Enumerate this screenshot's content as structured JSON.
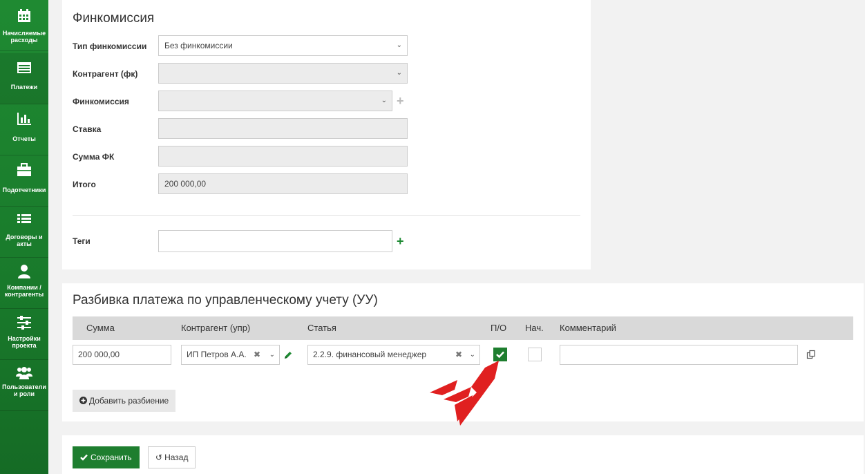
{
  "sidebar": {
    "items": [
      {
        "label": "Начисляемые расходы",
        "icon": "calendar-icon"
      },
      {
        "label": "Платежи",
        "icon": "payments-icon"
      },
      {
        "label": "Отчеты",
        "icon": "bar-chart-icon"
      },
      {
        "label": "Подотчетники",
        "icon": "briefcase-icon"
      },
      {
        "label": "Договоры и акты",
        "icon": "list-icon"
      },
      {
        "label": "Компании / контрагенты",
        "icon": "user-icon"
      },
      {
        "label": "Настройки проекта",
        "icon": "sliders-icon"
      },
      {
        "label": "Пользователи и роли",
        "icon": "users-icon"
      }
    ]
  },
  "fincommission": {
    "title": "Финкомиссия",
    "type_label": "Тип финкомиссии",
    "type_value": "Без финкомиссии",
    "counterparty_label": "Контрагент (фк)",
    "counterparty_value": "",
    "commission_label": "Финкомиссия",
    "commission_value": "",
    "rate_label": "Ставка",
    "rate_value": "",
    "sum_label": "Сумма ФК",
    "sum_value": "",
    "total_label": "Итого",
    "total_value": "200 000,00",
    "tags_label": "Теги",
    "tags_value": ""
  },
  "split": {
    "title": "Разбивка платежа по управленческому учету (УУ)",
    "columns": {
      "sum": "Сумма",
      "counterparty": "Контрагент (упр)",
      "article": "Статья",
      "po": "П/О",
      "nach": "Нач.",
      "comment": "Комментарий"
    },
    "row": {
      "sum": "200 000,00",
      "counterparty": "ИП Петров А.А.",
      "article": "2.2.9. финансовый менеджер",
      "po_checked": true,
      "nach_checked": false,
      "comment": ""
    },
    "add_button": "Добавить разбиение"
  },
  "footer": {
    "save_button": "Сохранить",
    "back_button": "Назад"
  },
  "colors": {
    "brand_green": "#1e7e2f",
    "annotation_red": "#e02020"
  }
}
